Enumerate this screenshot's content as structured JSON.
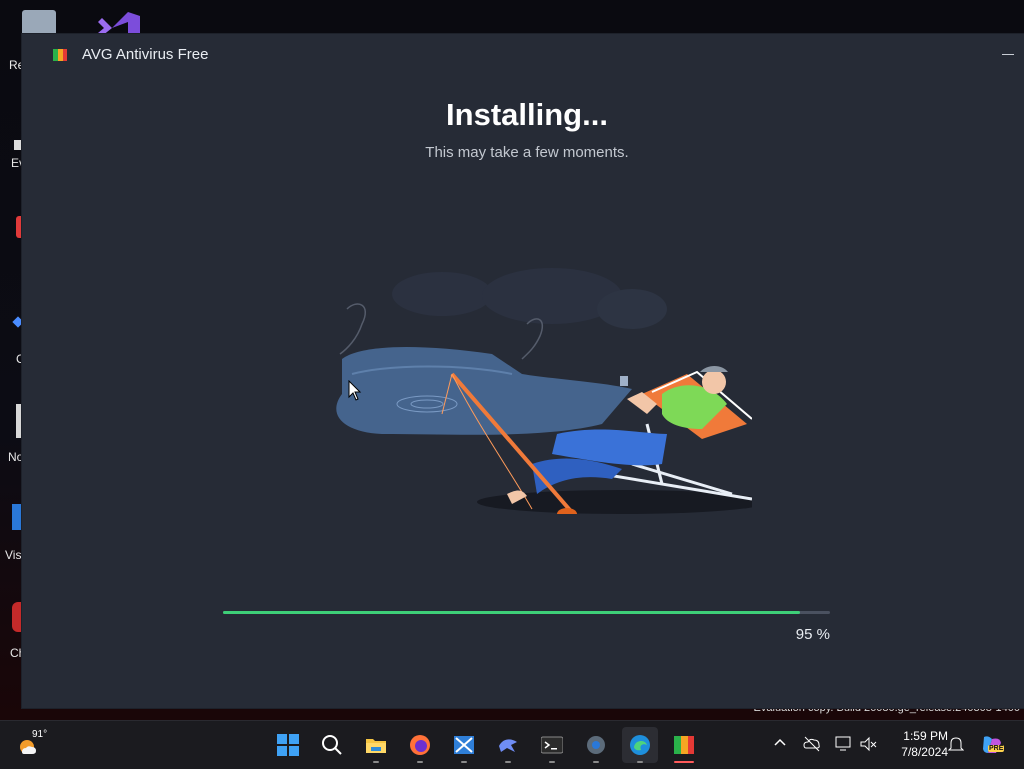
{
  "desktop": {
    "icon_labels": [
      "Re",
      "Ev",
      "C",
      "No",
      "Visu",
      "Ch"
    ],
    "watermark": "Evaluation copy. Build 26080.ge_release.240308-1400"
  },
  "window": {
    "title": "AVG Antivirus Free",
    "heading": "Installing...",
    "subheading": "This may take a few moments.",
    "progress_value": 95,
    "progress_text": "95 %"
  },
  "taskbar": {
    "weather_temp": "91°",
    "apps": [
      {
        "name": "start",
        "icon": "windows-logo-icon"
      },
      {
        "name": "search",
        "icon": "search-icon"
      },
      {
        "name": "file-explorer",
        "icon": "folder-icon"
      },
      {
        "name": "firefox",
        "icon": "firefox-icon"
      },
      {
        "name": "xp-tool",
        "icon": "xp-app-icon"
      },
      {
        "name": "bird-app",
        "icon": "bird-icon"
      },
      {
        "name": "terminal",
        "icon": "terminal-icon"
      },
      {
        "name": "settings",
        "icon": "gear-icon"
      },
      {
        "name": "edge",
        "icon": "edge-icon"
      },
      {
        "name": "avg-installer",
        "icon": "avg-icon"
      }
    ],
    "clock_time": "1:59 PM",
    "clock_date": "7/8/2024",
    "copilot_badge": "PRE"
  },
  "colors": {
    "window_bg": "#262b36",
    "progress_fill": "#3ecf78",
    "taskbar_bg": "#1b1b1f"
  }
}
